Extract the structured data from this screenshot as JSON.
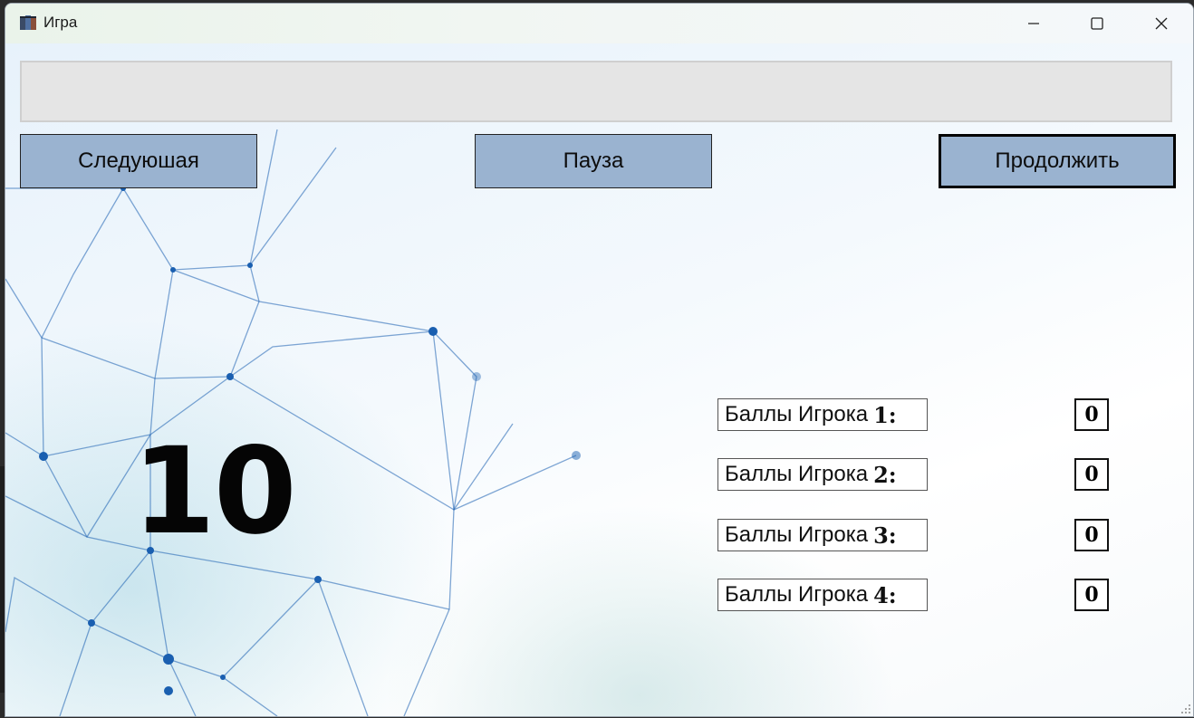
{
  "window": {
    "title": "Игра",
    "controls": {
      "minimize": "minimize-icon",
      "maximize": "maximize-icon",
      "close": "close-icon"
    }
  },
  "main": {
    "display_text": "",
    "buttons": {
      "next": "Следуюшая",
      "pause": "Пауза",
      "continue": "Продолжить"
    },
    "timer": "10",
    "scores": [
      {
        "label": "Баллы Игрока",
        "num": "1:",
        "value": "0"
      },
      {
        "label": "Баллы Игрока",
        "num": "2:",
        "value": "0"
      },
      {
        "label": "Баллы Игрока",
        "num": "3:",
        "value": "0"
      },
      {
        "label": "Баллы Игрока",
        "num": "4:",
        "value": "0"
      }
    ]
  },
  "colors": {
    "button_bg": "#9ab3d0",
    "display_bg": "#e5e5e5",
    "network_lines": "#1a5fb0"
  }
}
